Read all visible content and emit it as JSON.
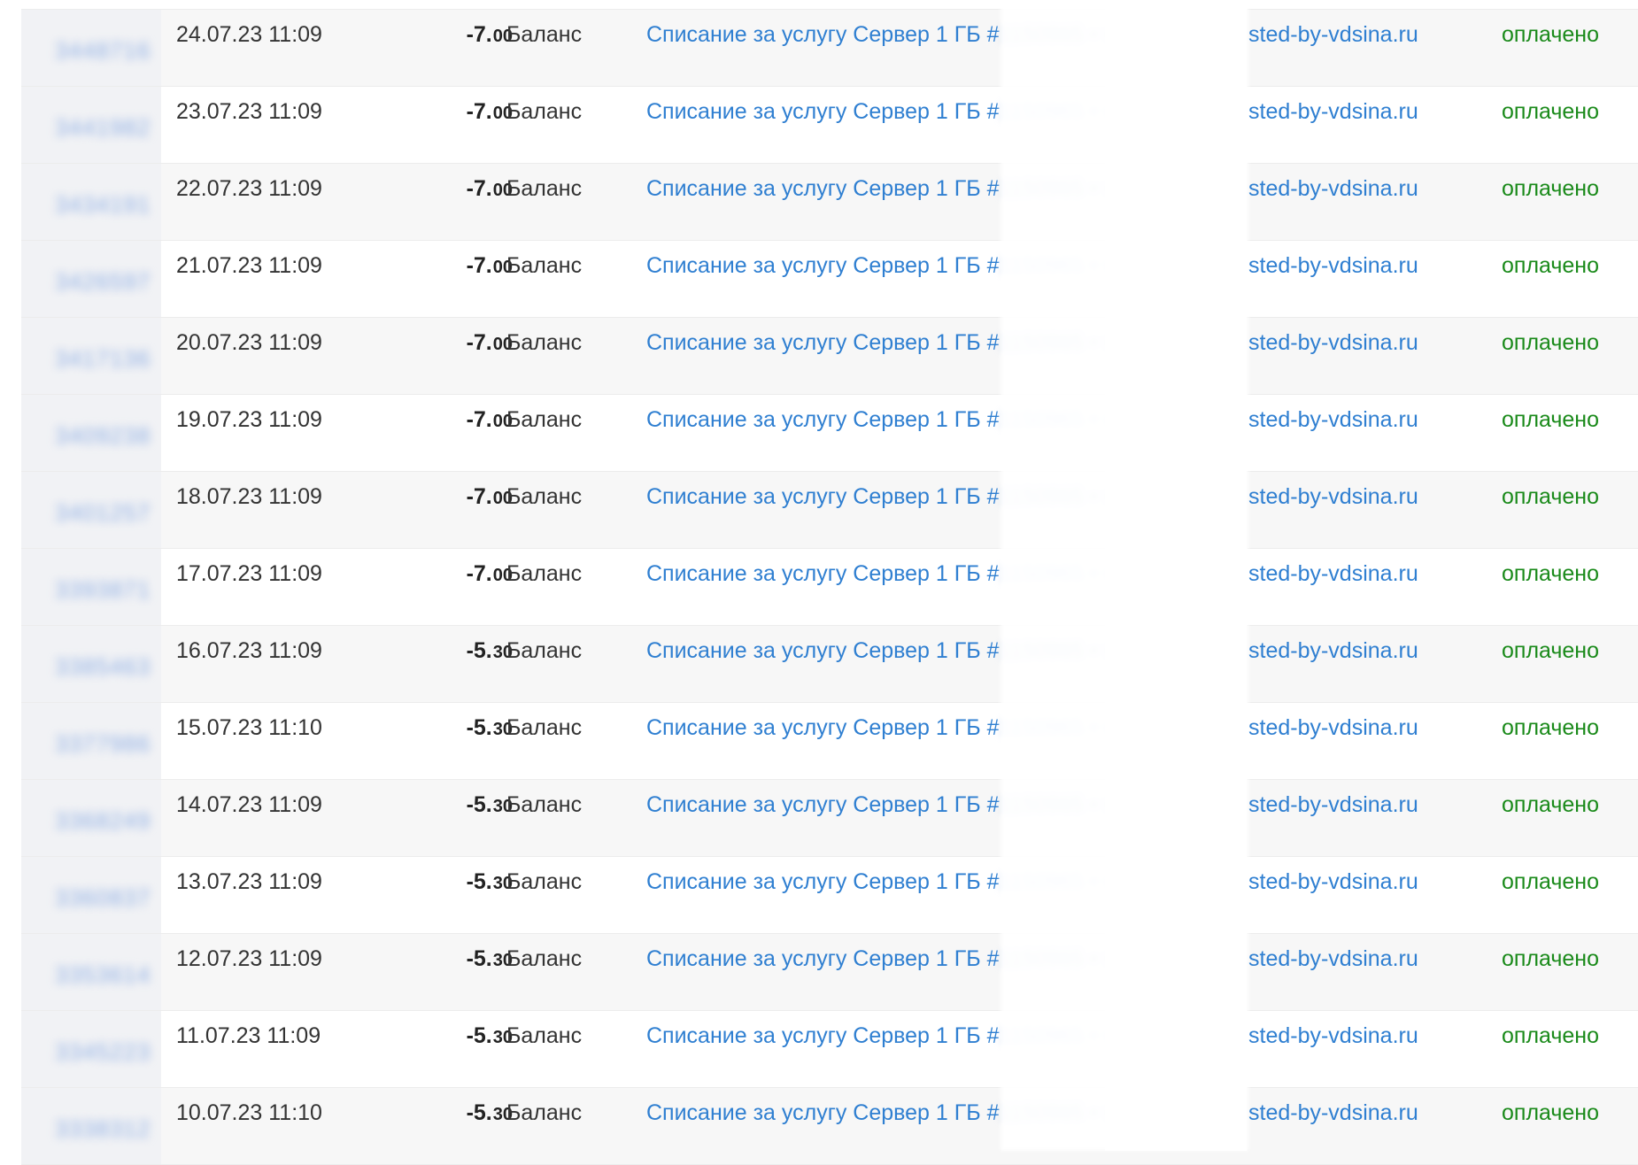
{
  "rows": [
    {
      "id": "3448716",
      "date": "24.07.23 11:09",
      "amount_int": "-7.",
      "amount_cents": "00",
      "method": "Баланс",
      "desc_start": "Списание за услугу Сервер 1 ГБ #",
      "desc_hidden": "1150965 • v1150965.ho",
      "desc_end": "sted-by-vdsina.ru",
      "status": "оплачено"
    },
    {
      "id": "3441982",
      "date": "23.07.23 11:09",
      "amount_int": "-7.",
      "amount_cents": "00",
      "method": "Баланс",
      "desc_start": "Списание за услугу Сервер 1 ГБ #",
      "desc_hidden": "1150965 • v1150965.ho",
      "desc_end": "sted-by-vdsina.ru",
      "status": "оплачено"
    },
    {
      "id": "3434191",
      "date": "22.07.23 11:09",
      "amount_int": "-7.",
      "amount_cents": "00",
      "method": "Баланс",
      "desc_start": "Списание за услугу Сервер 1 ГБ #",
      "desc_hidden": "1150965 • v1150965.ho",
      "desc_end": "sted-by-vdsina.ru",
      "status": "оплачено"
    },
    {
      "id": "3426597",
      "date": "21.07.23 11:09",
      "amount_int": "-7.",
      "amount_cents": "00",
      "method": "Баланс",
      "desc_start": "Списание за услугу Сервер 1 ГБ #",
      "desc_hidden": "1150965 • v1150965.ho",
      "desc_end": "sted-by-vdsina.ru",
      "status": "оплачено"
    },
    {
      "id": "3417136",
      "date": "20.07.23 11:09",
      "amount_int": "-7.",
      "amount_cents": "00",
      "method": "Баланс",
      "desc_start": "Списание за услугу Сервер 1 ГБ #",
      "desc_hidden": "1150965 • v1150965.ho",
      "desc_end": "sted-by-vdsina.ru",
      "status": "оплачено"
    },
    {
      "id": "3409238",
      "date": "19.07.23 11:09",
      "amount_int": "-7.",
      "amount_cents": "00",
      "method": "Баланс",
      "desc_start": "Списание за услугу Сервер 1 ГБ #",
      "desc_hidden": "1150965 • v1150965.ho",
      "desc_end": "sted-by-vdsina.ru",
      "status": "оплачено"
    },
    {
      "id": "3401257",
      "date": "18.07.23 11:09",
      "amount_int": "-7.",
      "amount_cents": "00",
      "method": "Баланс",
      "desc_start": "Списание за услугу Сервер 1 ГБ #",
      "desc_hidden": "1150965 • v1150965.ho",
      "desc_end": "sted-by-vdsina.ru",
      "status": "оплачено"
    },
    {
      "id": "3393871",
      "date": "17.07.23 11:09",
      "amount_int": "-7.",
      "amount_cents": "00",
      "method": "Баланс",
      "desc_start": "Списание за услугу Сервер 1 ГБ #",
      "desc_hidden": "1150965 • v1150965.ho",
      "desc_end": "sted-by-vdsina.ru",
      "status": "оплачено"
    },
    {
      "id": "3385463",
      "date": "16.07.23 11:09",
      "amount_int": "-5.",
      "amount_cents": "30",
      "method": "Баланс",
      "desc_start": "Списание за услугу Сервер 1 ГБ #",
      "desc_hidden": "1150965 • v1150965.ho",
      "desc_end": "sted-by-vdsina.ru",
      "status": "оплачено"
    },
    {
      "id": "3377986",
      "date": "15.07.23 11:10",
      "amount_int": "-5.",
      "amount_cents": "30",
      "method": "Баланс",
      "desc_start": "Списание за услугу Сервер 1 ГБ #",
      "desc_hidden": "1150965 • v1150965.ho",
      "desc_end": "sted-by-vdsina.ru",
      "status": "оплачено"
    },
    {
      "id": "3368249",
      "date": "14.07.23 11:09",
      "amount_int": "-5.",
      "amount_cents": "30",
      "method": "Баланс",
      "desc_start": "Списание за услугу Сервер 1 ГБ #",
      "desc_hidden": "1150965 • v1150965.ho",
      "desc_end": "sted-by-vdsina.ru",
      "status": "оплачено"
    },
    {
      "id": "3360837",
      "date": "13.07.23 11:09",
      "amount_int": "-5.",
      "amount_cents": "30",
      "method": "Баланс",
      "desc_start": "Списание за услугу Сервер 1 ГБ #",
      "desc_hidden": "1150965 • v1150965.ho",
      "desc_end": "sted-by-vdsina.ru",
      "status": "оплачено"
    },
    {
      "id": "3353614",
      "date": "12.07.23 11:09",
      "amount_int": "-5.",
      "amount_cents": "30",
      "method": "Баланс",
      "desc_start": "Списание за услугу Сервер 1 ГБ #",
      "desc_hidden": "1150965 • v1150965.ho",
      "desc_end": "sted-by-vdsina.ru",
      "status": "оплачено"
    },
    {
      "id": "3345223",
      "date": "11.07.23 11:09",
      "amount_int": "-5.",
      "amount_cents": "30",
      "method": "Баланс",
      "desc_start": "Списание за услугу Сервер 1 ГБ #",
      "desc_hidden": "1150965 • v1150965.ho",
      "desc_end": "sted-by-vdsina.ru",
      "status": "оплачено"
    },
    {
      "id": "3338312",
      "date": "10.07.23 11:10",
      "amount_int": "-5.",
      "amount_cents": "30",
      "method": "Баланс",
      "desc_start": "Списание за услугу Сервер 1 ГБ #",
      "desc_hidden": "1150965 • v1150965.ho",
      "desc_end": "sted-by-vdsina.ru",
      "status": "оплачено"
    }
  ],
  "colors": {
    "link": "#2f7fd1",
    "status_paid": "#1a8a1a",
    "row_stripe": "#f7f7f7"
  }
}
